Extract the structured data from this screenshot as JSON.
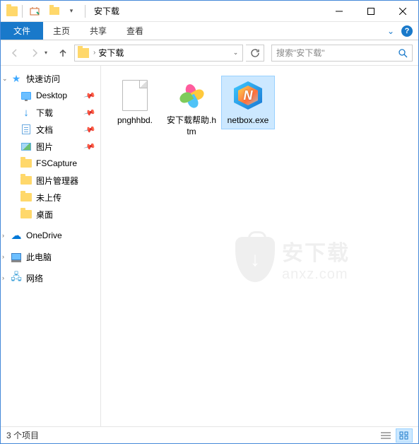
{
  "window": {
    "title": "安下载"
  },
  "ribbon": {
    "file": "文件",
    "tabs": [
      "主页",
      "共享",
      "查看"
    ]
  },
  "address": {
    "current": "安下载",
    "search_placeholder": "搜索\"安下载\""
  },
  "sidebar": {
    "quick_access": "快速访问",
    "items": [
      {
        "label": "Desktop",
        "pinned": true
      },
      {
        "label": "下载",
        "pinned": true
      },
      {
        "label": "文档",
        "pinned": true
      },
      {
        "label": "图片",
        "pinned": true
      },
      {
        "label": "FSCapture",
        "pinned": false
      },
      {
        "label": "图片管理器",
        "pinned": false
      },
      {
        "label": "未上传",
        "pinned": false
      },
      {
        "label": "桌面",
        "pinned": false
      }
    ],
    "onedrive": "OneDrive",
    "thispc": "此电脑",
    "network": "网络"
  },
  "files": [
    {
      "name": "pnghhbd.",
      "type": "blank"
    },
    {
      "name": "安下载帮助.htm",
      "type": "htm"
    },
    {
      "name": "netbox.exe",
      "type": "exe",
      "selected": true
    }
  ],
  "watermark": {
    "cn": "安下载",
    "en": "anxz.com"
  },
  "status": {
    "count": "3 个项目"
  }
}
